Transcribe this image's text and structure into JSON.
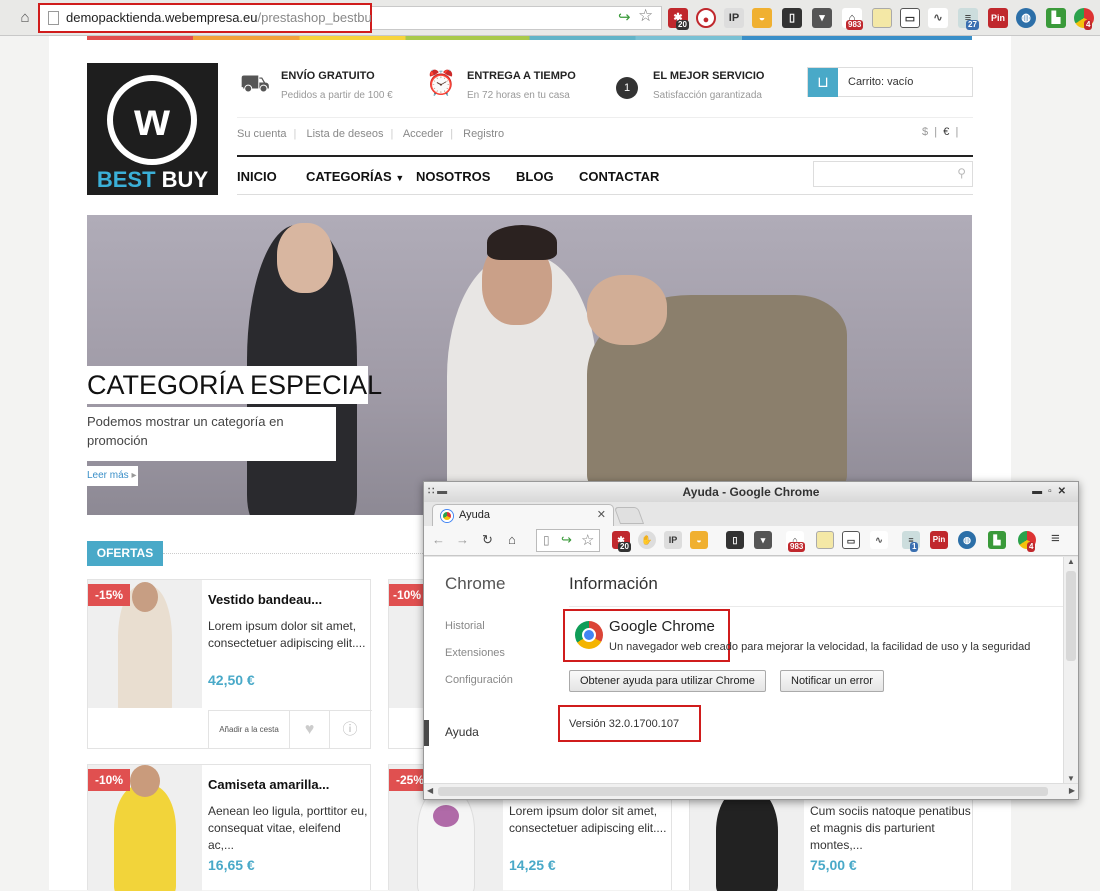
{
  "browser": {
    "url_host": "demopacktienda.webempresa.eu",
    "url_path": "/prestashop_bestbuy/",
    "extension_badges": {
      "a": "20",
      "b": "983",
      "c": "27",
      "d": "4",
      "pin": "Pin",
      "ip": "IP"
    }
  },
  "logo": {
    "word1": "BEST",
    "word2": "BUY",
    "glyph": "w"
  },
  "features": [
    {
      "title": "ENVÍO GRATUITO",
      "subtitle": "Pedidos a partir de 100 €",
      "icon": "truck-icon"
    },
    {
      "title": "ENTREGA A TIEMPO",
      "subtitle": "En 72 horas en tu casa",
      "icon": "alarm-clock-icon"
    },
    {
      "title": "EL MEJOR SERVICIO",
      "subtitle": "Satisfacción garantizada",
      "icon": "award-ribbon-icon",
      "ribbon_number": "1"
    }
  ],
  "cart": {
    "label": "Carrito: vacío"
  },
  "account_nav": [
    "Su cuenta",
    "Lista de deseos",
    "Acceder",
    "Registro"
  ],
  "currency": {
    "a": "$",
    "b": "€"
  },
  "main_nav": [
    "INICIO",
    "CATEGORÍAS",
    "NOSOTROS",
    "BLOG",
    "CONTACTAR"
  ],
  "banner": {
    "title": "CATEGORÍA ESPECIAL",
    "subtitle": "Podemos mostrar un categoría en promoción",
    "more": "Leer más"
  },
  "ofertas": {
    "label": "OFERTAS"
  },
  "products": [
    {
      "discount": "-15%",
      "name": "Vestido bandeau...",
      "desc": "Lorem ipsum dolor sit amet, consectetuer adipiscing elit....",
      "price": "42,50 €",
      "add": "Añadir a la cesta"
    },
    {
      "discount": "-10%",
      "name": "",
      "desc": "",
      "price": ""
    },
    {
      "discount": "-10%",
      "name": "Camiseta amarilla...",
      "desc": "Aenean leo ligula, porttitor eu, consequat vitae, eleifend ac,...",
      "price": "16,65 €"
    },
    {
      "discount": "-25%",
      "name": "",
      "desc": "Lorem ipsum dolor sit amet, consectetuer adipiscing elit....",
      "price": "14,25 €"
    },
    {
      "discount": "",
      "name": "",
      "desc": "Cum sociis natoque penatibus et magnis dis parturient montes,...",
      "price": "75,00 €"
    }
  ],
  "chrome_window": {
    "title": "Ayuda - Google Chrome",
    "tab": "Ayuda",
    "sidebar_title": "Chrome",
    "sidebar_items": [
      "Historial",
      "Extensiones",
      "Configuración"
    ],
    "sidebar_selected": "Ayuda",
    "main_title": "Información",
    "app_name": "Google Chrome",
    "app_desc": "Un navegador web creado para mejorar la velocidad, la facilidad de uso y la seguridad",
    "btn_help": "Obtener ayuda para utilizar Chrome",
    "btn_report": "Notificar un error",
    "version": "Versión 32.0.1700.107",
    "badges": {
      "a": "20",
      "b": "983",
      "c": "1",
      "d": "4",
      "pin": "Pin",
      "ip": "IP"
    }
  },
  "colors": {
    "accent": "#49a9c8",
    "discount": "#e05050",
    "highlight_box": "#d01c1c"
  }
}
